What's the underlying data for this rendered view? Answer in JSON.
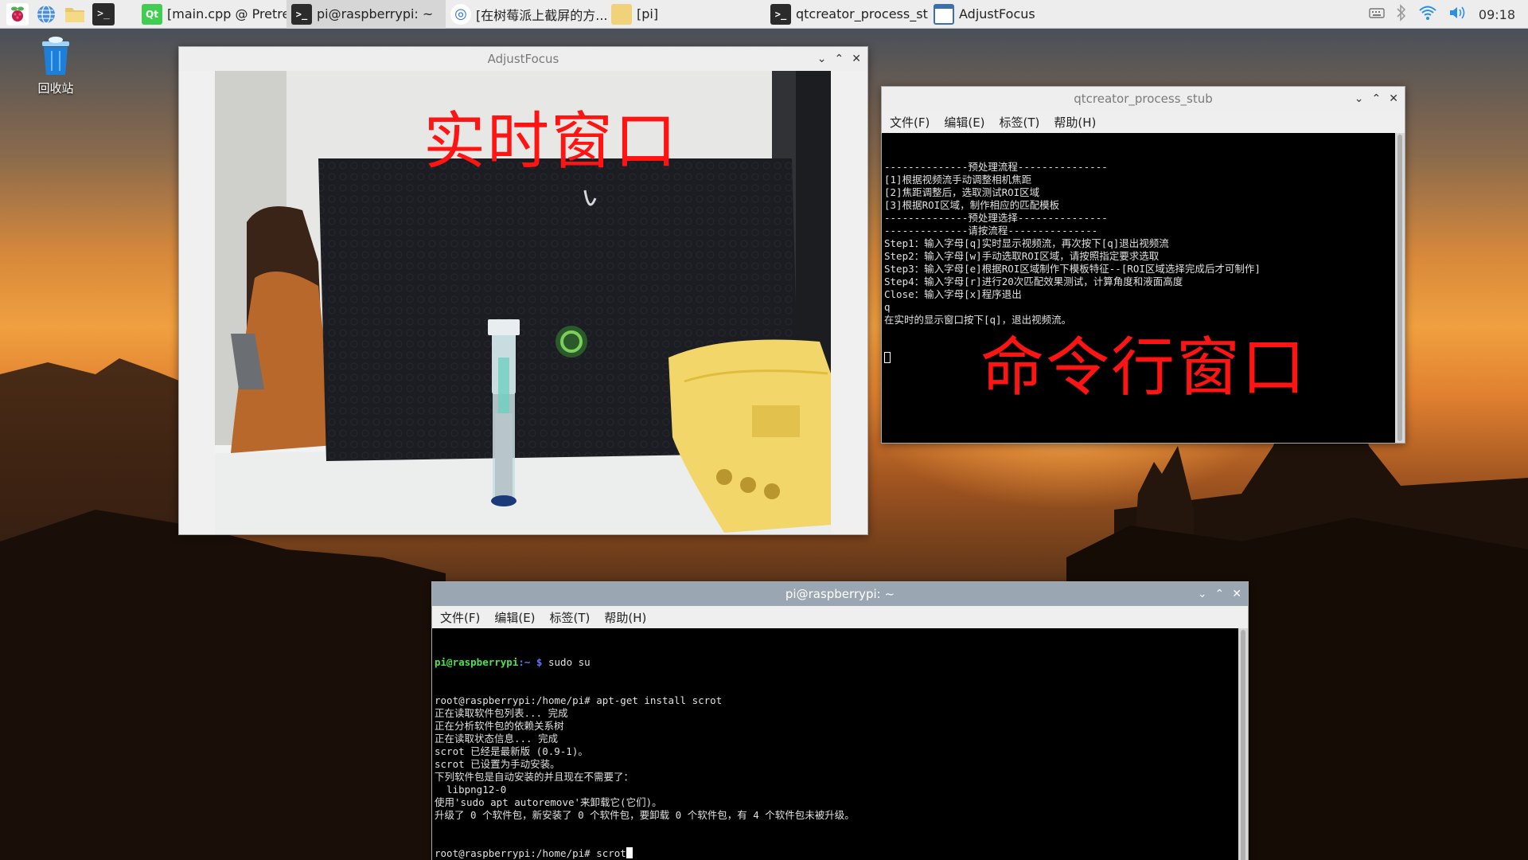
{
  "taskbar": {
    "launchers": [
      {
        "icon": "raspberry-menu-icon"
      },
      {
        "icon": "web-browser-icon"
      },
      {
        "icon": "file-manager-icon"
      },
      {
        "icon": "terminal-icon"
      }
    ],
    "tasks": [
      {
        "icon": "qt-icon",
        "label": "[main.cpp @ Pretreat...",
        "active": false
      },
      {
        "icon": "terminal-icon",
        "label": "pi@raspberrypi: ~",
        "active": true
      },
      {
        "icon": "chromium-icon",
        "label": "[在树莓派上截屏的方...",
        "active": false
      },
      {
        "icon": "folder-icon",
        "label": "[pi]",
        "active": false
      },
      {
        "icon": "terminal-icon",
        "label": "qtcreator_process_stub",
        "active": false
      },
      {
        "icon": "window-icon",
        "label": "AdjustFocus",
        "active": false
      }
    ],
    "clock": "09:18"
  },
  "desktop": {
    "trash_label": "回收站"
  },
  "windows": {
    "adjust_focus": {
      "title": "AdjustFocus",
      "overlay_label": "实时窗口"
    },
    "process_stub": {
      "title": "qtcreator_process_stub",
      "menu": [
        "文件(F)",
        "编辑(E)",
        "标签(T)",
        "帮助(H)"
      ],
      "lines": [
        "--------------预处理流程---------------",
        "[1]根据视频流手动调整相机焦距",
        "[2]焦距调整后，选取测试ROI区域",
        "[3]根据ROI区域，制作相应的匹配模板",
        "--------------预处理选择---------------",
        "--------------请按流程---------------",
        "Step1：输入字母[q]实时显示视频流，再次按下[q]退出视频流",
        "Step2：输入字母[w]手动选取ROI区域，请按照指定要求选取",
        "Step3：输入字母[e]根据ROI区域制作下模板特征--[ROI区域选择完成后才可制作]",
        "Step4：输入字母[r]进行20次匹配效果测试，计算角度和液面高度",
        "Close：输入字母[x]程序退出",
        "q",
        "在实时的显示窗口按下[q]，退出视频流。"
      ],
      "overlay_label": "命令行窗口"
    },
    "terminal": {
      "title": "pi@raspberrypi: ~",
      "menu": [
        "文件(F)",
        "编辑(E)",
        "标签(T)",
        "帮助(H)"
      ],
      "prompt_user": "pi@raspberrypi",
      "prompt_path": ":~ $",
      "first_cmd": " sudo su",
      "lines": [
        "root@raspberrypi:/home/pi# apt-get install scrot",
        "正在读取软件包列表... 完成",
        "正在分析软件包的依赖关系树",
        "正在读取状态信息... 完成",
        "scrot 已经是最新版 (0.9-1)。",
        "scrot 已设置为手动安装。",
        "下列软件包是自动安装的并且现在不需要了：",
        "  libpng12-0",
        "使用'sudo apt autoremove'来卸载它(它们)。",
        "升级了 0 个软件包，新安装了 0 个软件包，要卸载 0 个软件包，有 4 个软件包未被升级。",
        "root@raspberrypi:/home/pi# scrot"
      ],
      "current_line": "root@raspberrypi:/home/pi# scrot"
    }
  }
}
